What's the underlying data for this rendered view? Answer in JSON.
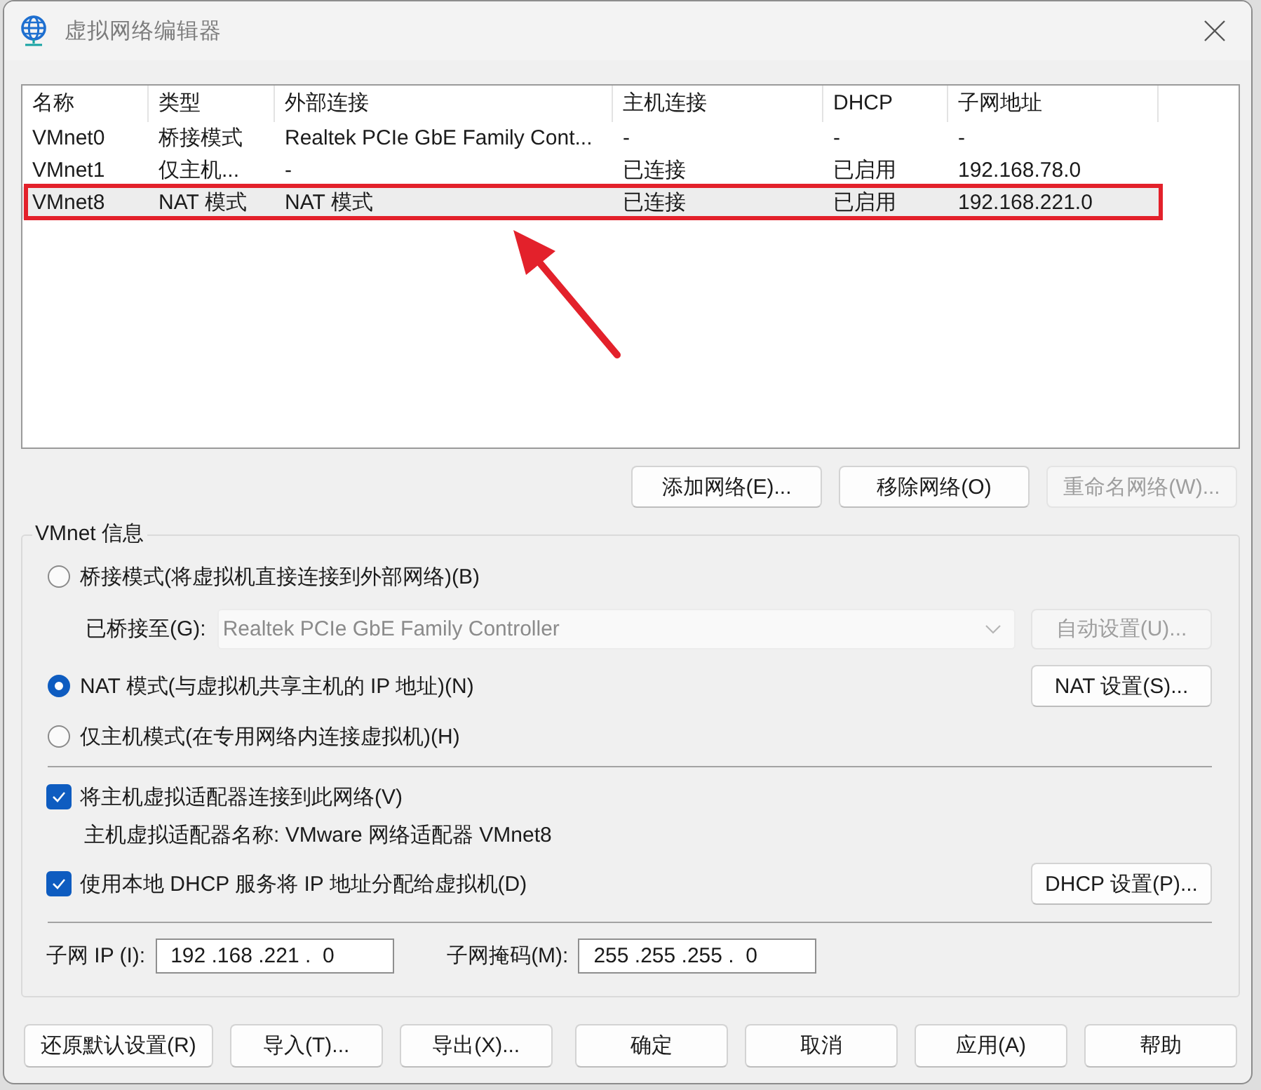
{
  "window": {
    "title": "虚拟网络编辑器"
  },
  "network_table": {
    "columns": [
      "名称",
      "类型",
      "外部连接",
      "主机连接",
      "DHCP",
      "子网地址"
    ],
    "rows": [
      {
        "cells": [
          "VMnet0",
          "桥接模式",
          "Realtek PCIe GbE Family Cont...",
          "-",
          "-",
          "-"
        ],
        "selected": false,
        "highlighted": false
      },
      {
        "cells": [
          "VMnet1",
          "仅主机...",
          "-",
          "已连接",
          "已启用",
          "192.168.78.0"
        ],
        "selected": false,
        "highlighted": false
      },
      {
        "cells": [
          "VMnet8",
          "NAT 模式",
          "NAT 模式",
          "已连接",
          "已启用",
          "192.168.221.0"
        ],
        "selected": true,
        "highlighted": true
      }
    ]
  },
  "table_buttons": [
    {
      "label": "添加网络(E)...",
      "disabled": false
    },
    {
      "label": "移除网络(O)",
      "disabled": false
    },
    {
      "label": "重命名网络(W)...",
      "disabled": true
    }
  ],
  "vmnet_info": {
    "title": "VMnet 信息",
    "modes": [
      {
        "label": "桥接模式(将虚拟机直接连接到外部网络)(B)",
        "selected": false
      },
      {
        "label": "NAT 模式(与虚拟机共享主机的 IP 地址)(N)",
        "selected": true
      },
      {
        "label": "仅主机模式(在专用网络内连接虚拟机)(H)",
        "selected": false
      }
    ],
    "bridged_to": {
      "label": "已桥接至(G):",
      "value": "Realtek PCIe GbE Family Controller",
      "disabled": true
    },
    "auto_settings_button": {
      "label": "自动设置(U)...",
      "disabled": true
    },
    "nat_settings_button": {
      "label": "NAT 设置(S)...",
      "disabled": false
    },
    "host_adapter": {
      "label": "将主机虚拟适配器连接到此网络(V)",
      "checked": true
    },
    "host_adapter_name": "主机虚拟适配器名称: VMware 网络适配器 VMnet8",
    "dhcp": {
      "label": "使用本地 DHCP 服务将 IP 地址分配给虚拟机(D)",
      "checked": true
    },
    "dhcp_settings_button": {
      "label": "DHCP 设置(P)...",
      "disabled": false
    },
    "subnet_ip": {
      "label": "子网 IP (I):",
      "value": "192 .168 .221 .  0"
    },
    "subnet_mask": {
      "label": "子网掩码(M):",
      "value": "255 .255 .255 .  0"
    }
  },
  "file_buttons": [
    {
      "label": "还原默认设置(R)",
      "disabled": false
    },
    {
      "label": "导入(T)...",
      "disabled": false
    },
    {
      "label": "导出(X)...",
      "disabled": false
    }
  ],
  "dialog_buttons": [
    {
      "label": "确定",
      "disabled": false
    },
    {
      "label": "取消",
      "disabled": false
    },
    {
      "label": "应用(A)",
      "disabled": false
    },
    {
      "label": "帮助",
      "disabled": false
    }
  ]
}
